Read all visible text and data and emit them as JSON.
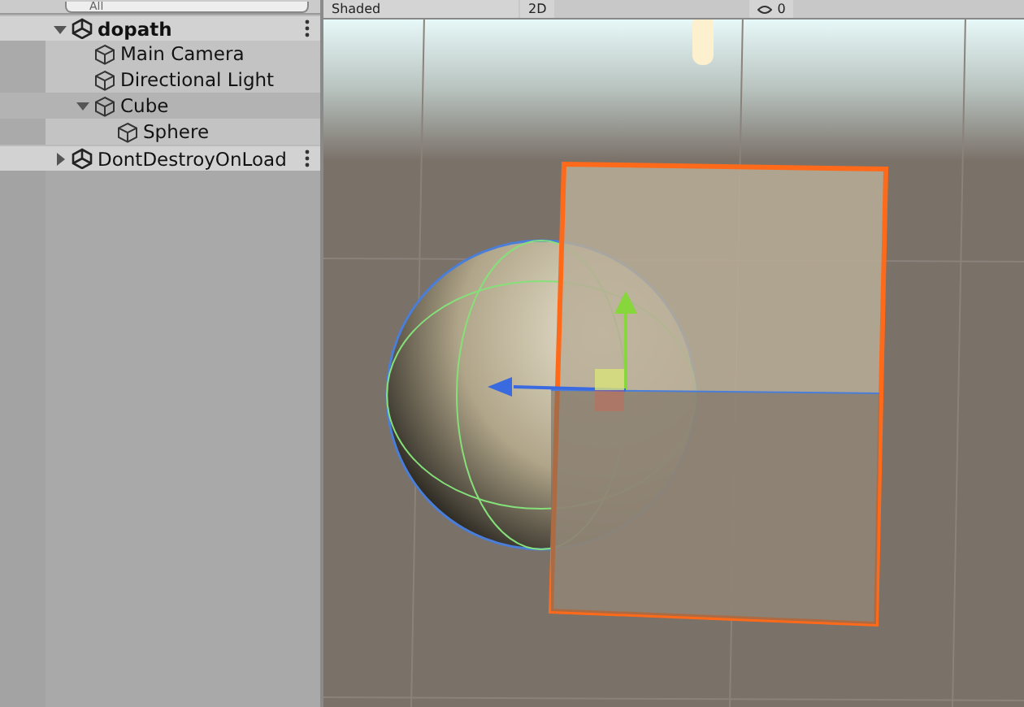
{
  "hierarchy": {
    "search": {
      "placeholder": "All"
    },
    "items": [
      {
        "kind": "scene",
        "label": "dopath",
        "active": true,
        "expanded": true,
        "selected": false,
        "children": [
          {
            "kind": "object",
            "label": "Main Camera",
            "selected": false
          },
          {
            "kind": "object",
            "label": "Directional Light",
            "selected": false
          },
          {
            "kind": "object",
            "label": "Cube",
            "expanded": true,
            "selected": true,
            "children": [
              {
                "kind": "object",
                "label": "Sphere",
                "selected": false
              }
            ]
          }
        ]
      },
      {
        "kind": "scene",
        "label": "DontDestroyOnLoad",
        "active": false,
        "expanded": false,
        "selected": false
      }
    ]
  },
  "scene_view": {
    "toolbar": {
      "draw_mode": "Shaded",
      "mode_2d": "2D",
      "hidden_count": "0"
    }
  }
}
